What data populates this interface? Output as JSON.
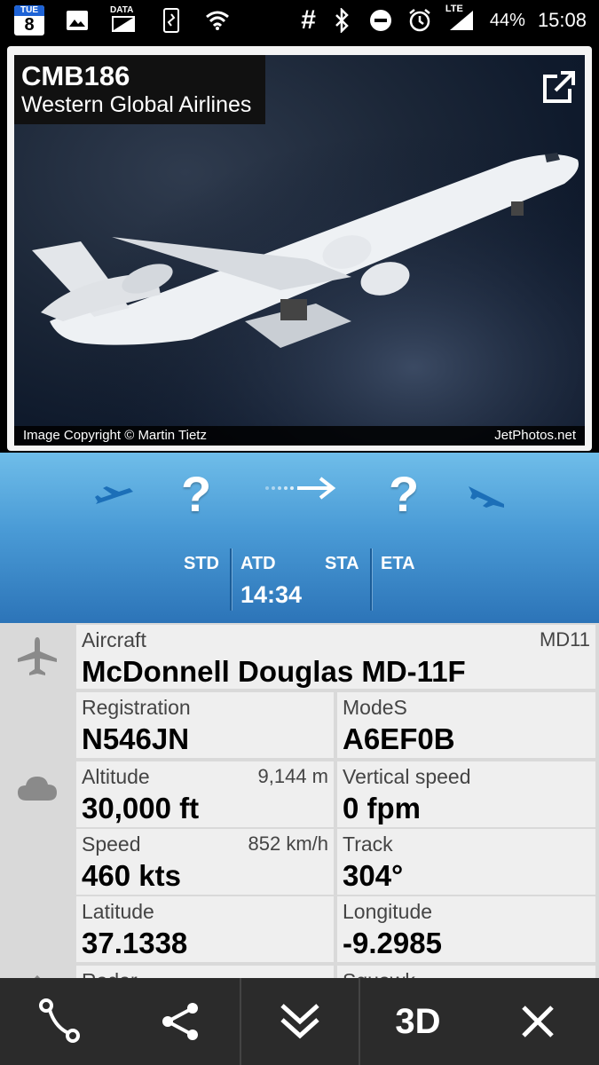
{
  "status_bar": {
    "calendar_day_name": "TUE",
    "calendar_day_num": "8",
    "data_label": "DATA",
    "network": "LTE",
    "battery": "44%",
    "time": "15:08",
    "icons": [
      "calendar-icon",
      "image-icon",
      "data-saver-icon",
      "vibrate-icon",
      "wifi-icon",
      "hash-icon",
      "bluetooth-icon",
      "dnd-icon",
      "alarm-icon",
      "signal-icon"
    ]
  },
  "flight": {
    "callsign": "CMB186",
    "airline": "Western Global Airlines"
  },
  "photo": {
    "copyright": "Image Copyright © Martin Tietz",
    "source": "JetPhotos.net"
  },
  "route": {
    "origin": "?",
    "destination": "?",
    "std_label": "STD",
    "atd_label": "ATD",
    "atd_time": "14:34",
    "sta_label": "STA",
    "eta_label": "ETA"
  },
  "details": {
    "aircraft_label": "Aircraft",
    "aircraft_code": "MD11",
    "aircraft_value": "McDonnell Douglas MD-11F",
    "registration_label": "Registration",
    "registration_value": "N546JN",
    "modes_label": "ModeS",
    "modes_value": "A6EF0B",
    "altitude_label": "Altitude",
    "altitude_metric": "9,144 m",
    "altitude_value": "30,000 ft",
    "vspeed_label": "Vertical speed",
    "vspeed_value": "0 fpm",
    "speed_label": "Speed",
    "speed_metric": "852 km/h",
    "speed_value": "460 kts",
    "track_label": "Track",
    "track_value": "304°",
    "latitude_label": "Latitude",
    "latitude_value": "37.1338",
    "longitude_label": "Longitude",
    "longitude_value": "-9.2985",
    "radar_label": "Radar",
    "squawk_label": "Squawk"
  },
  "bottom_bar": {
    "three_d_label": "3D"
  }
}
